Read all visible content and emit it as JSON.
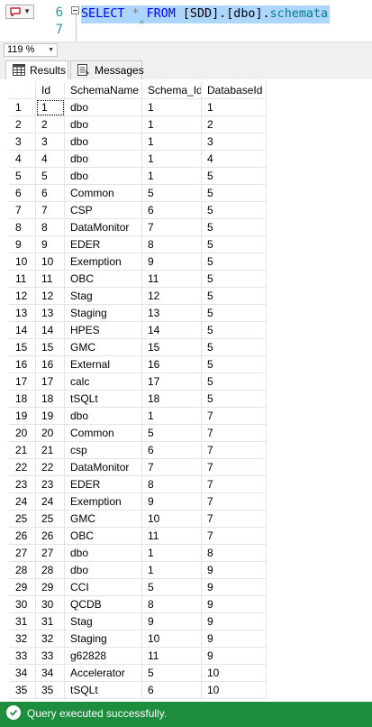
{
  "editor": {
    "line_numbers": [
      "6",
      "7"
    ],
    "code": {
      "kw1": "SELECT",
      "star": "*",
      "kw2": "FROM",
      "rest": "[SDD].[dbo].",
      "fn": "schemata"
    }
  },
  "zoom": {
    "value": "119 %"
  },
  "tabs": {
    "results": "Results",
    "messages": "Messages"
  },
  "grid": {
    "headers": [
      "",
      "Id",
      "SchemaName",
      "Schema_Id",
      "DatabaseId"
    ],
    "rows": [
      [
        "1",
        "1",
        "dbo",
        "1",
        "1"
      ],
      [
        "2",
        "2",
        "dbo",
        "1",
        "2"
      ],
      [
        "3",
        "3",
        "dbo",
        "1",
        "3"
      ],
      [
        "4",
        "4",
        "dbo",
        "1",
        "4"
      ],
      [
        "5",
        "5",
        "dbo",
        "1",
        "5"
      ],
      [
        "6",
        "6",
        "Common",
        "5",
        "5"
      ],
      [
        "7",
        "7",
        "CSP",
        "6",
        "5"
      ],
      [
        "8",
        "8",
        "DataMonitor",
        "7",
        "5"
      ],
      [
        "9",
        "9",
        "EDER",
        "8",
        "5"
      ],
      [
        "10",
        "10",
        "Exemption",
        "9",
        "5"
      ],
      [
        "11",
        "11",
        "OBC",
        "11",
        "5"
      ],
      [
        "12",
        "12",
        "Stag",
        "12",
        "5"
      ],
      [
        "13",
        "13",
        "Staging",
        "13",
        "5"
      ],
      [
        "14",
        "14",
        "HPES",
        "14",
        "5"
      ],
      [
        "15",
        "15",
        "GMC",
        "15",
        "5"
      ],
      [
        "16",
        "16",
        "External",
        "16",
        "5"
      ],
      [
        "17",
        "17",
        "calc",
        "17",
        "5"
      ],
      [
        "18",
        "18",
        "tSQLt",
        "18",
        "5"
      ],
      [
        "19",
        "19",
        "dbo",
        "1",
        "7"
      ],
      [
        "20",
        "20",
        "Common",
        "5",
        "7"
      ],
      [
        "21",
        "21",
        "csp",
        "6",
        "7"
      ],
      [
        "22",
        "22",
        "DataMonitor",
        "7",
        "7"
      ],
      [
        "23",
        "23",
        "EDER",
        "8",
        "7"
      ],
      [
        "24",
        "24",
        "Exemption",
        "9",
        "7"
      ],
      [
        "25",
        "25",
        "GMC",
        "10",
        "7"
      ],
      [
        "26",
        "26",
        "OBC",
        "11",
        "7"
      ],
      [
        "27",
        "27",
        "dbo",
        "1",
        "8"
      ],
      [
        "28",
        "28",
        "dbo",
        "1",
        "9"
      ],
      [
        "29",
        "29",
        "CCI",
        "5",
        "9"
      ],
      [
        "30",
        "30",
        "QCDB",
        "8",
        "9"
      ],
      [
        "31",
        "31",
        "Stag",
        "9",
        "9"
      ],
      [
        "32",
        "32",
        "Staging",
        "10",
        "9"
      ],
      [
        "33",
        "33",
        "g62828",
        "11",
        "9"
      ],
      [
        "34",
        "34",
        "Accelerator",
        "5",
        "10"
      ],
      [
        "35",
        "35",
        "tSQLt",
        "6",
        "10"
      ]
    ]
  },
  "status": {
    "text": "Query executed successfully."
  },
  "colors": {
    "status_bar": "#1e8e3e",
    "selection": "#add6ff",
    "keyword": "#0000ff",
    "line_number": "#2b91af"
  }
}
